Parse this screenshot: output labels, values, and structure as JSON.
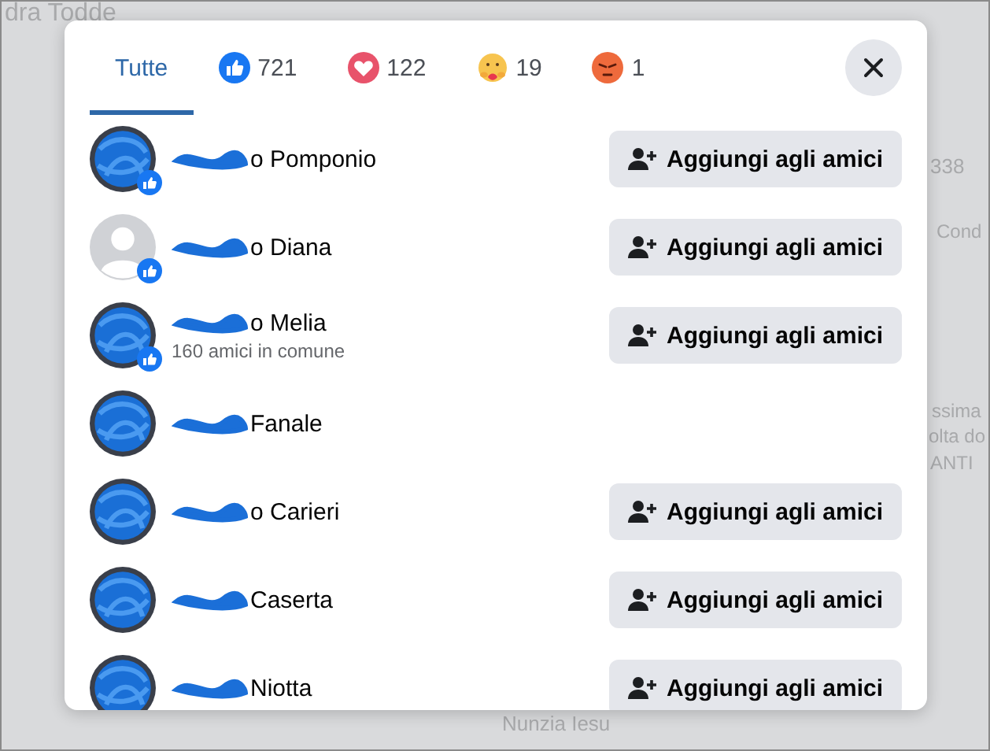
{
  "background": {
    "texts": [
      "dra Todde",
      "338",
      "Cond",
      "ssima",
      "olta do",
      "ANTI",
      "Nunzia Iesu"
    ]
  },
  "tabs": [
    {
      "kind": "all",
      "label": "Tutte",
      "selected": true
    },
    {
      "kind": "like",
      "label": "721",
      "selected": false
    },
    {
      "kind": "love",
      "label": "122",
      "selected": false
    },
    {
      "kind": "care",
      "label": "19",
      "selected": false
    },
    {
      "kind": "angry",
      "label": "1",
      "selected": false
    }
  ],
  "people": [
    {
      "name": "o Pomponio",
      "kind": "photo",
      "badge": true,
      "button": "Aggiungi agli amici"
    },
    {
      "name": "o Diana",
      "kind": "default",
      "badge": true,
      "button": "Aggiungi agli amici"
    },
    {
      "name": "o Melia",
      "subtitle": "160 amici in comune",
      "kind": "photo",
      "badge": true,
      "button": "Aggiungi agli amici"
    },
    {
      "name": "Fanale",
      "kind": "photo",
      "badge": false
    },
    {
      "name": "o Carieri",
      "kind": "photo",
      "badge": false,
      "button": "Aggiungi agli amici"
    },
    {
      "name": "Caserta",
      "kind": "photo",
      "badge": false,
      "button": "Aggiungi agli amici"
    },
    {
      "name": "Niotta",
      "kind": "photo",
      "badge": false,
      "button": "Aggiungi agli amici"
    }
  ]
}
